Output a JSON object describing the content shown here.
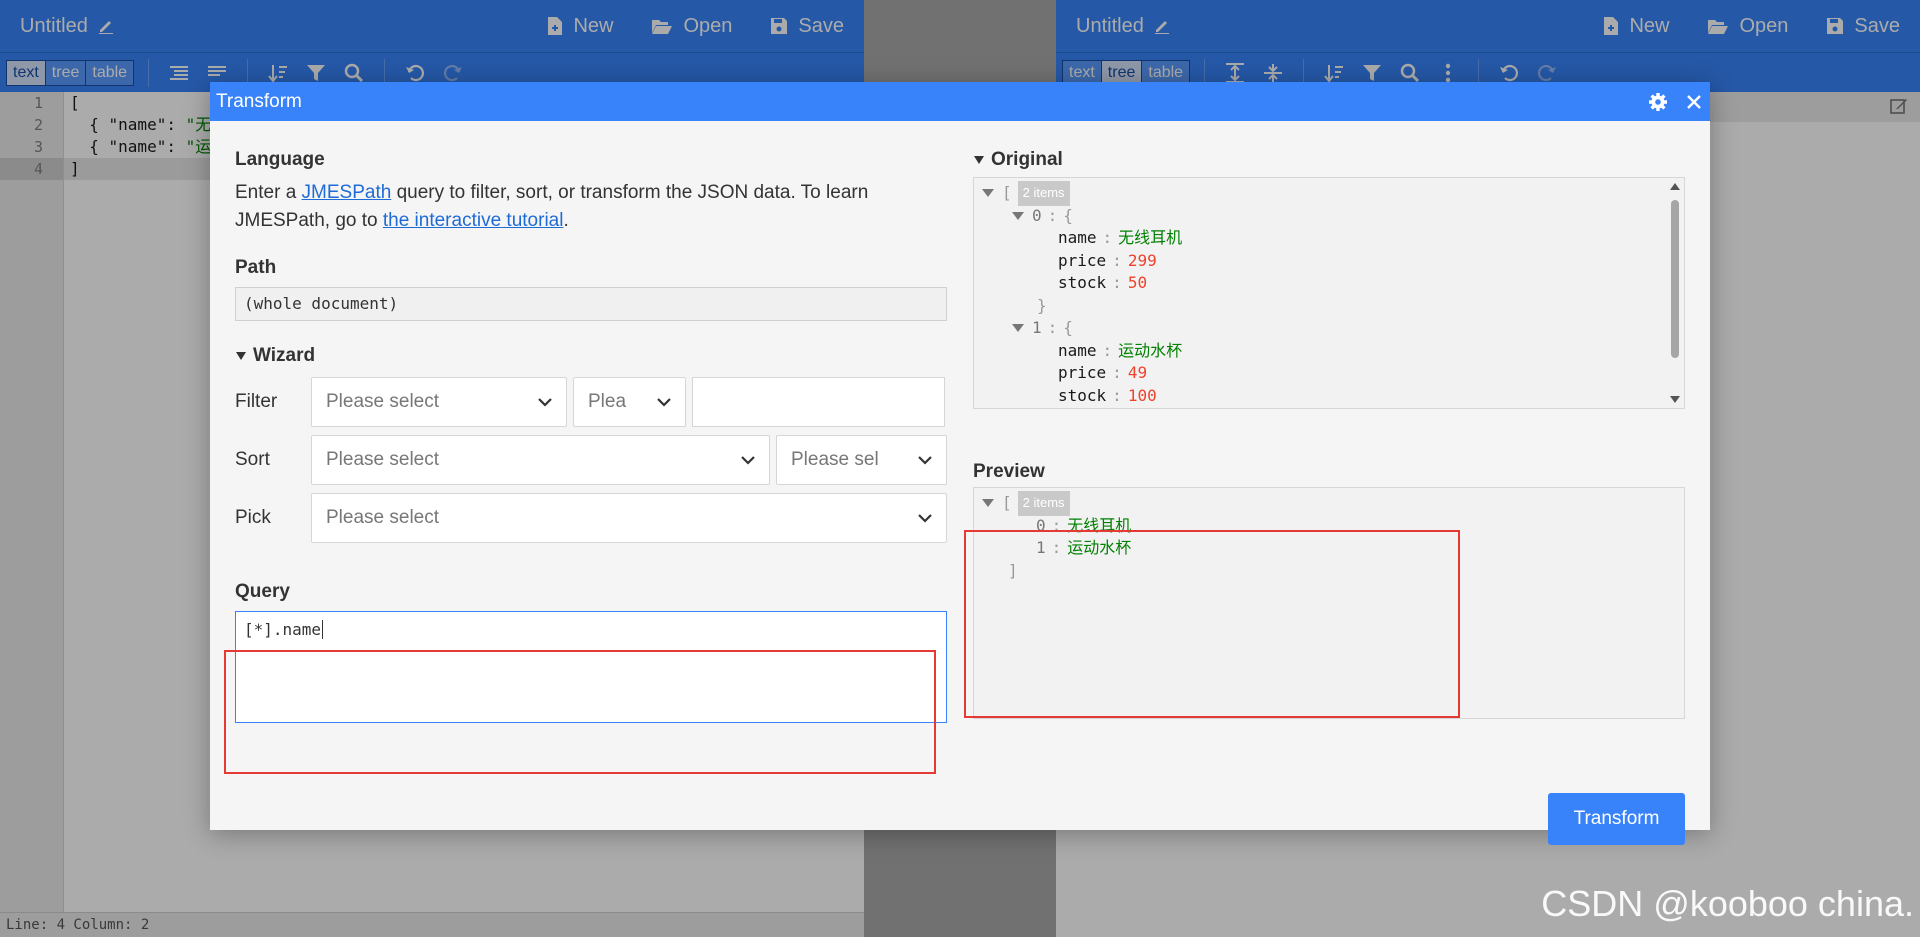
{
  "left_editor": {
    "title": "Untitled",
    "menu": {
      "new": "New",
      "open": "Open",
      "save": "Save"
    },
    "modes": [
      "text",
      "tree",
      "table"
    ],
    "active_mode": "text",
    "line_numbers": [
      "1",
      "2",
      "3",
      "4"
    ],
    "code": {
      "l1": "[",
      "l2_key": "  { \"name\": ",
      "l2_val": "\"无",
      "l3_key": "  { \"name\": ",
      "l3_val": "\"运",
      "l4": "]"
    },
    "status": "Line: 4  Column: 2"
  },
  "right_editor": {
    "title": "Untitled",
    "menu": {
      "new": "New",
      "open": "Open",
      "save": "Save"
    },
    "modes": [
      "text",
      "tree",
      "table"
    ],
    "active_mode": "tree"
  },
  "modal": {
    "title": "Transform",
    "language": {
      "heading": "Language",
      "text1": "Enter a ",
      "link1": "JMESPath",
      "text2": " query to filter, sort, or transform the JSON data. To learn JMESPath, go to ",
      "link2": "the interactive tutorial",
      "text3": "."
    },
    "path": {
      "heading": "Path",
      "value": "(whole document)"
    },
    "wizard": {
      "heading": "Wizard",
      "filter_label": "Filter",
      "sort_label": "Sort",
      "pick_label": "Pick",
      "placeholder": "Please select",
      "filter_op_placeholder": "Plea",
      "sort_order_placeholder": "Please sel"
    },
    "query": {
      "heading": "Query",
      "value": "[*].name"
    },
    "original": {
      "heading": "Original",
      "badge": "2 items",
      "items": [
        {
          "index": "0",
          "name": "无线耳机",
          "price": "299",
          "stock": "50"
        },
        {
          "index": "1",
          "name": "运动水杯",
          "price": "49",
          "stock": "100"
        }
      ],
      "keys": {
        "name": "name",
        "price": "price",
        "stock": "stock"
      }
    },
    "preview": {
      "heading": "Preview",
      "badge": "2 items",
      "items": [
        {
          "index": "0",
          "value": "无线耳机"
        },
        {
          "index": "1",
          "value": "运动水杯"
        }
      ]
    },
    "transform_button": "Transform"
  },
  "watermark": "CSDN @kooboo china.",
  "colors": {
    "primary": "#3883fa",
    "string": "#008000",
    "number": "#ee422e",
    "highlight": "#e53935"
  }
}
